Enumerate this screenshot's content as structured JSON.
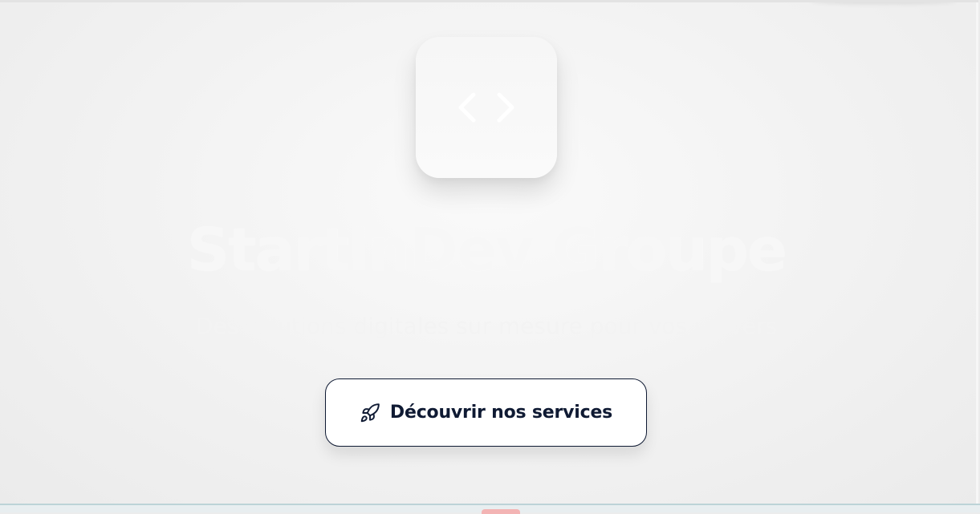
{
  "hero": {
    "logo_icon": "code-brackets-icon",
    "title": "StartInDev Groupe",
    "subtitle": "Des solutions digitales sur mesure pour vos univers",
    "cta": {
      "icon": "rocket-icon",
      "label": "Découvrir nos services"
    }
  },
  "colors": {
    "background": "#ececec",
    "tile": "#f8f8f8",
    "title_text": "#f7f7f7",
    "button_border": "#0f1a33",
    "button_text": "#0f1a33",
    "button_background": "#ffffff"
  }
}
